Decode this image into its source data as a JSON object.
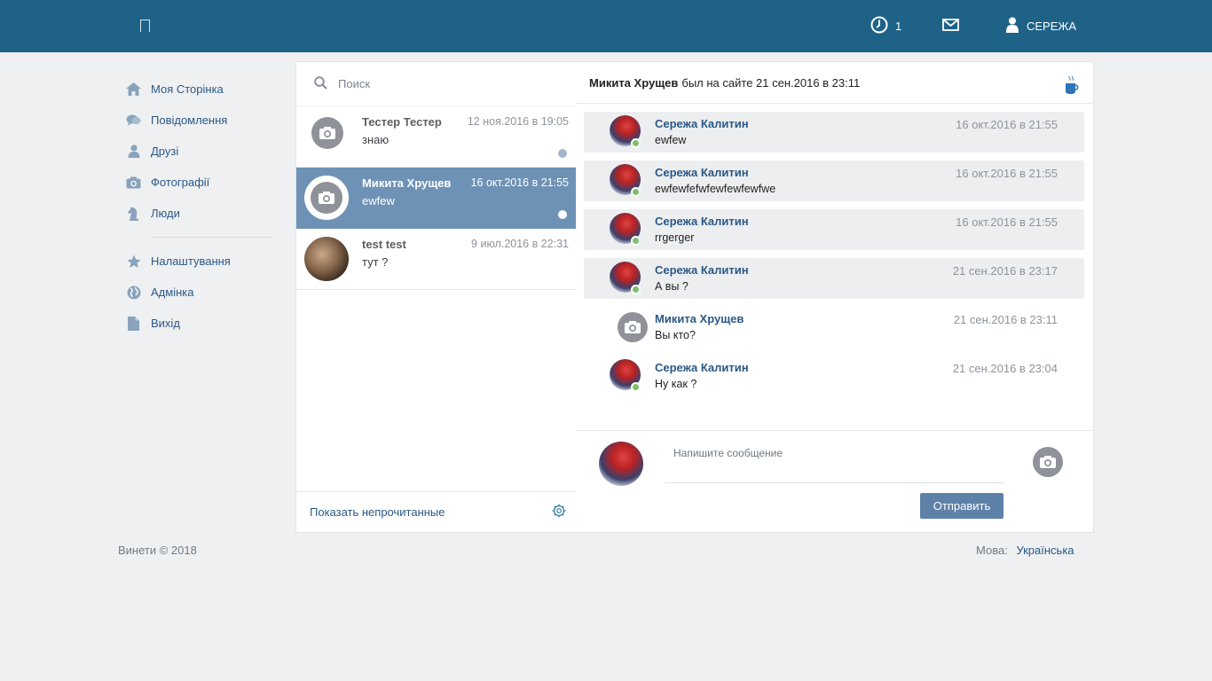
{
  "header": {
    "notifications_count": "1",
    "user_name": "СЕРЕЖА"
  },
  "nav": {
    "items": [
      {
        "label": "Моя Сторінка",
        "icon": "home-icon"
      },
      {
        "label": "Повідомлення",
        "icon": "chat-bubble-icon"
      },
      {
        "label": "Друзі",
        "icon": "person-icon"
      },
      {
        "label": "Фотографії",
        "icon": "camera-icon"
      },
      {
        "label": "Люди",
        "icon": "chess-knight-icon"
      }
    ],
    "items2": [
      {
        "label": "Налаштування",
        "icon": "star-icon"
      },
      {
        "label": "Адмінка",
        "icon": "globe-icon"
      },
      {
        "label": "Вихід",
        "icon": "document-icon"
      }
    ]
  },
  "dialogs": {
    "search_placeholder": "Поиск",
    "list": [
      {
        "name": "Тестер Тестер",
        "time": "12 ноя.2016 в 19:05",
        "message": "знаю"
      },
      {
        "name": "Микита Хрущев",
        "time": "16 окт.2016 в 21:55",
        "message": "ewfew"
      },
      {
        "name": "test test",
        "time": "9 июл.2016 в 22:31",
        "message": "тут ?"
      }
    ],
    "show_unread": "Показать непрочитанные"
  },
  "chat": {
    "partner": "Микита Хрущев",
    "status": "был на сайте 21 сен.2016 в 23:11",
    "messages": [
      {
        "author": "Сережа Калитин",
        "time": "16 окт.2016 в 21:55",
        "text": "ewfew"
      },
      {
        "author": "Сережа Калитин",
        "time": "16 окт.2016 в 21:55",
        "text": "ewfewfefwfewfewfewfwe"
      },
      {
        "author": "Сережа Калитин",
        "time": "16 окт.2016 в 21:55",
        "text": "rrgerger"
      },
      {
        "author": "Сережа Калитин",
        "time": "21 сен.2016 в 23:17",
        "text": "А вы ?"
      },
      {
        "author": "Микита Хрущев",
        "time": "21 сен.2016 в 23:11",
        "text": "Вы кто?"
      },
      {
        "author": "Сережа Калитин",
        "time": "21 сен.2016 в 23:04",
        "text": "Ну как ?"
      }
    ],
    "composer_placeholder": "Напишите сообщение",
    "send_label": "Отправить"
  },
  "footer": {
    "copyright": "Винети © 2018",
    "lang_label": "Мова:",
    "lang_value": "Українська"
  },
  "colors": {
    "header_bg": "#1e6287",
    "accent": "#2a5885",
    "active_dialog": "#6e92b5",
    "send_button": "#5e81a8",
    "online": "#7dc06b"
  }
}
